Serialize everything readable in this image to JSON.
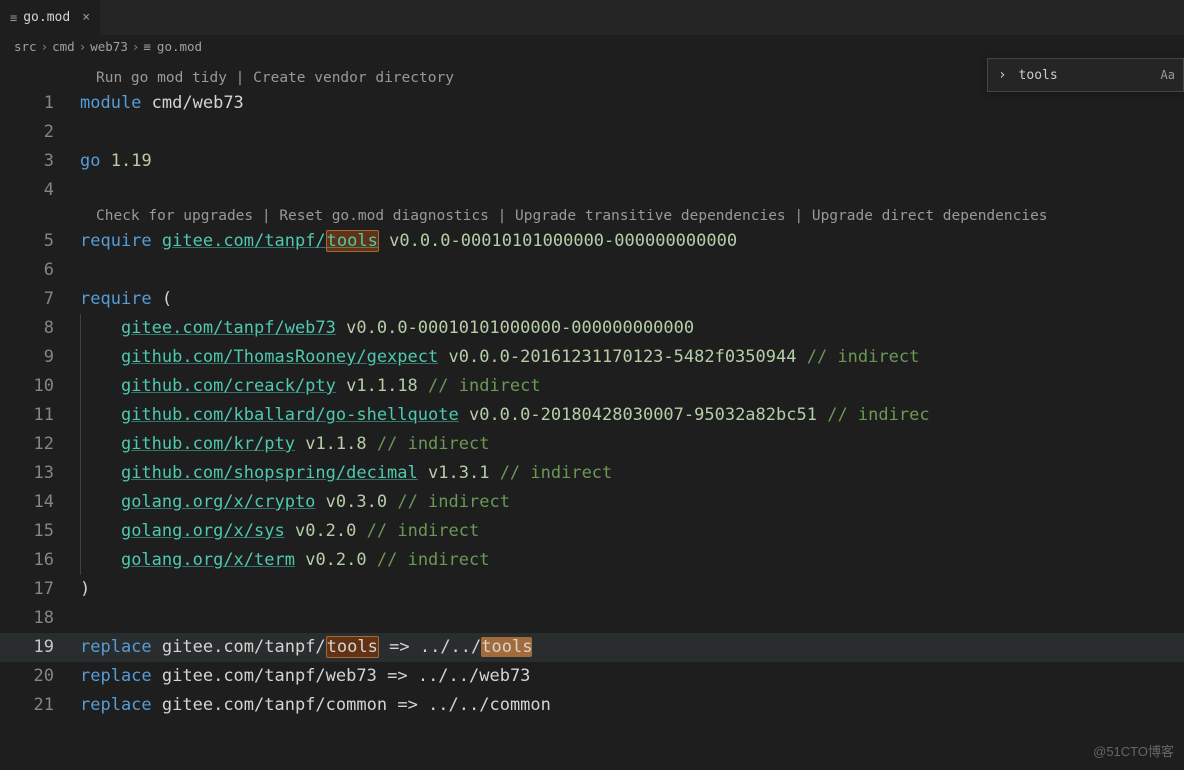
{
  "tab": {
    "filename": "go.mod"
  },
  "breadcrumb": {
    "p1": "src",
    "p2": "cmd",
    "p3": "web73",
    "p4": "go.mod"
  },
  "find": {
    "value": "tools",
    "aa": "Aa"
  },
  "codelens1": "Run go mod tidy | Create vendor directory",
  "codelens2": "Check for upgrades | Reset go.mod diagnostics | Upgrade transitive dependencies | Upgrade direct dependencies",
  "l1": {
    "kw": "module",
    "val": "cmd/web73"
  },
  "l3": {
    "kw": "go",
    "val": "1.19"
  },
  "l5": {
    "kw": "require",
    "pkg_pre": "gitee.com/tanpf/",
    "pkg_hl": "tools",
    "ver": "v0.0.0-00010101000000-000000000000"
  },
  "l7": {
    "kw": "require",
    "paren": "("
  },
  "l8": {
    "pkg": "gitee.com/tanpf/web73",
    "ver": "v0.0.0-00010101000000-000000000000"
  },
  "l9": {
    "pkg": "github.com/ThomasRooney/gexpect",
    "ver": "v0.0.0-20161231170123-5482f0350944",
    "c": "// indirect"
  },
  "l10": {
    "pkg": "github.com/creack/pty",
    "ver": "v1.1.18",
    "c": "// indirect"
  },
  "l11": {
    "pkg": "github.com/kballard/go-shellquote",
    "ver": "v0.0.0-20180428030007-95032a82bc51",
    "c": "// indirec"
  },
  "l12": {
    "pkg": "github.com/kr/pty",
    "ver": "v1.1.8",
    "c": "// indirect"
  },
  "l13": {
    "pkg": "github.com/shopspring/decimal",
    "ver": "v1.3.1",
    "c": "// indirect"
  },
  "l14": {
    "pkg": "golang.org/x/crypto",
    "ver": "v0.3.0",
    "c": "// indirect"
  },
  "l15": {
    "pkg": "golang.org/x/sys",
    "ver": "v0.2.0",
    "c": "// indirect"
  },
  "l16": {
    "pkg": "golang.org/x/term",
    "ver": "v0.2.0",
    "c": "// indirect"
  },
  "l17": {
    "paren": ")"
  },
  "l19": {
    "kw": "replace",
    "path_pre": "gitee.com/tanpf/",
    "path_hl": "tools",
    "arrow": "=>",
    "rhs_pre": "../../",
    "rhs_hl": "tools"
  },
  "l20": {
    "kw": "replace",
    "path": "gitee.com/tanpf/web73",
    "arrow": "=>",
    "rhs": "../../web73"
  },
  "l21": {
    "kw": "replace",
    "path": "gitee.com/tanpf/common",
    "arrow": "=>",
    "rhs": "../../common"
  },
  "watermark": "@51CTO博客"
}
